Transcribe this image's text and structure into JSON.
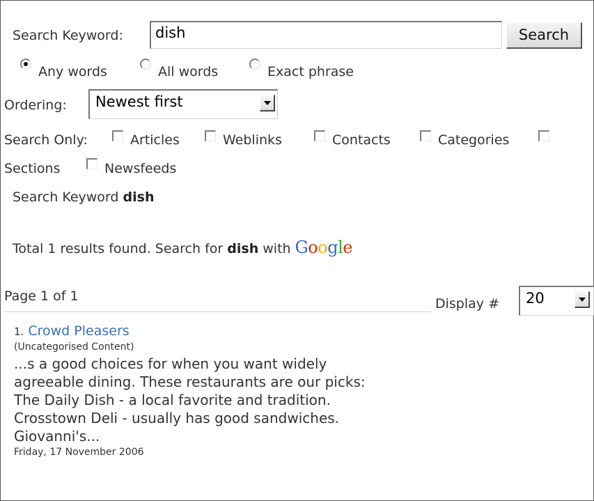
{
  "search_form": {
    "keyword_label": "Search Keyword:",
    "keyword_value": "dish",
    "search_button": "Search",
    "match_options": [
      {
        "label": "Any words",
        "checked": true
      },
      {
        "label": "All words",
        "checked": false
      },
      {
        "label": "Exact phrase",
        "checked": false
      }
    ],
    "ordering_label": "Ordering:",
    "ordering_value": "Newest first",
    "search_only_label": "Search Only:",
    "areas": [
      {
        "label": "Articles",
        "checked": false
      },
      {
        "label": "Weblinks",
        "checked": false
      },
      {
        "label": "Contacts",
        "checked": false
      },
      {
        "label": "Categories",
        "checked": false
      },
      {
        "label": "Sections",
        "checked": false
      },
      {
        "label": "Newsfeeds",
        "checked": false
      }
    ]
  },
  "summary": {
    "keyword_prefix": "Search Keyword",
    "keyword": "dish",
    "total_text": "Total 1 results found. Search for",
    "total_keyword": "dish",
    "with_text": "with",
    "google_letters": [
      "G",
      "o",
      "o",
      "g",
      "l",
      "e"
    ],
    "google_colors": [
      "#3366cc",
      "#cc3300",
      "#eeb000",
      "#3366cc",
      "#33aa33",
      "#cc3300"
    ]
  },
  "pagination": {
    "page_text": "Page 1 of 1",
    "display_label": "Display #",
    "display_value": "20"
  },
  "results": [
    {
      "number": "1.",
      "title": "Crowd Pleasers",
      "section": "(Uncategorised Content)",
      "excerpt": "...s a good choices for when you want widely agreeable dining. These restaurants are our picks: The Daily Dish - a local favorite and tradition. Crosstown Deli - usually has good sandwiches. Giovanni's...",
      "date": "Friday, 17 November 2006"
    }
  ]
}
